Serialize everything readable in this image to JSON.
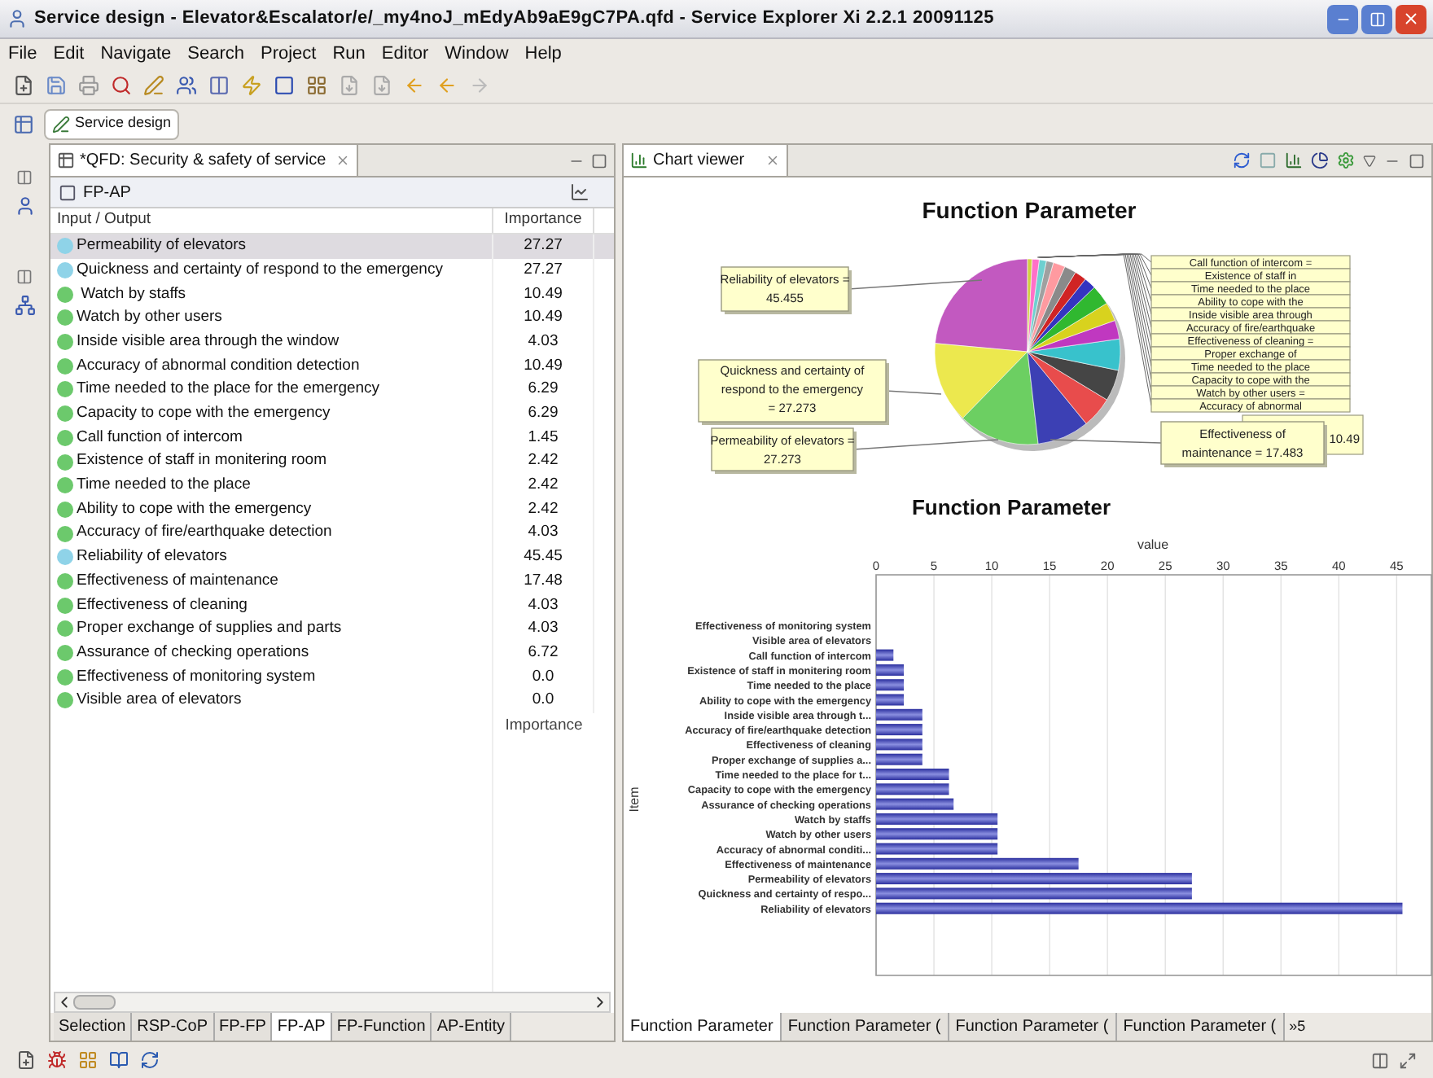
{
  "window": {
    "title": "Service design - Elevator&Escalator/e/_my4noJ_mEdyAb9aE9gC7PA.qfd - Service Explorer Xi 2.2.1 20091125"
  },
  "menu": [
    "File",
    "Edit",
    "Navigate",
    "Search",
    "Project",
    "Run",
    "Editor",
    "Window",
    "Help"
  ],
  "perspective": {
    "label": "Service design"
  },
  "editor": {
    "tab": "*QFD: Security & safety of service",
    "section": "FP-AP",
    "columns": [
      "Input / Output",
      "Importance"
    ],
    "rows": [
      {
        "name": "Permeability of elevators",
        "importance": "27.27",
        "color": "#8fd3e8",
        "selected": true
      },
      {
        "name": "Quickness and certainty of respond to the emergency",
        "importance": "27.27",
        "color": "#8fd3e8",
        "selected": false
      },
      {
        "name": " Watch by staffs",
        "importance": "10.49",
        "color": "#6cc96c",
        "selected": false
      },
      {
        "name": "Watch by other users",
        "importance": "10.49",
        "color": "#6cc96c",
        "selected": false
      },
      {
        "name": "Inside visible area through the window",
        "importance": "4.03",
        "color": "#6cc96c",
        "selected": false
      },
      {
        "name": "Accuracy of abnormal condition detection",
        "importance": "10.49",
        "color": "#6cc96c",
        "selected": false
      },
      {
        "name": "Time needed to the place for the emergency",
        "importance": "6.29",
        "color": "#6cc96c",
        "selected": false
      },
      {
        "name": "Capacity to cope with the emergency",
        "importance": "6.29",
        "color": "#6cc96c",
        "selected": false
      },
      {
        "name": "Call function of intercom",
        "importance": "1.45",
        "color": "#6cc96c",
        "selected": false
      },
      {
        "name": "Existence of staff in monitering room",
        "importance": "2.42",
        "color": "#6cc96c",
        "selected": false
      },
      {
        "name": "Time needed to the place",
        "importance": "2.42",
        "color": "#6cc96c",
        "selected": false
      },
      {
        "name": "Ability to cope with the emergency",
        "importance": "2.42",
        "color": "#6cc96c",
        "selected": false
      },
      {
        "name": "Accuracy of fire/earthquake detection",
        "importance": "4.03",
        "color": "#6cc96c",
        "selected": false
      },
      {
        "name": "Reliability of elevators",
        "importance": "45.45",
        "color": "#8fd3e8",
        "selected": false
      },
      {
        "name": "Effectiveness of maintenance",
        "importance": "17.48",
        "color": "#6cc96c",
        "selected": false
      },
      {
        "name": "Effectiveness of cleaning",
        "importance": "4.03",
        "color": "#6cc96c",
        "selected": false
      },
      {
        "name": "Proper exchange of supplies and parts",
        "importance": "4.03",
        "color": "#6cc96c",
        "selected": false
      },
      {
        "name": "Assurance of checking operations",
        "importance": "6.72",
        "color": "#6cc96c",
        "selected": false
      },
      {
        "name": "Effectiveness of monitoring system",
        "importance": "0.0",
        "color": "#6cc96c",
        "selected": false
      },
      {
        "name": "Visible area of elevators",
        "importance": "0.0",
        "color": "#6cc96c",
        "selected": false
      }
    ],
    "footer": "Importance",
    "sheet_tabs": [
      {
        "label": "Selection",
        "selected": false
      },
      {
        "label": "RSP-CoP",
        "selected": false
      },
      {
        "label": "FP-FP",
        "selected": false
      },
      {
        "label": "FP-AP",
        "selected": true
      },
      {
        "label": "FP-Function",
        "selected": false
      },
      {
        "label": "AP-Entity",
        "selected": false
      }
    ]
  },
  "chart_viewer": {
    "title": "Chart viewer",
    "pie": {
      "title": "Function Parameter",
      "callouts": [
        {
          "kind": "box",
          "lines": [
            "Reliability of elevators =",
            "45.455"
          ]
        },
        {
          "kind": "box",
          "lines": [
            "Quickness and certainty of",
            "respond to the emergency",
            "= 27.273"
          ]
        },
        {
          "kind": "box",
          "lines": [
            "Permeability of elevators =",
            "27.273"
          ]
        },
        {
          "kind": "stacked",
          "lines": [
            "Call function of intercom ="
          ]
        },
        {
          "kind": "stacked",
          "lines": [
            "Existence of staff in"
          ]
        },
        {
          "kind": "stacked",
          "lines": [
            "Time needed to the place"
          ]
        },
        {
          "kind": "stacked",
          "lines": [
            "Ability to cope with the"
          ]
        },
        {
          "kind": "stacked",
          "lines": [
            "Inside visible area through"
          ]
        },
        {
          "kind": "stacked",
          "lines": [
            "Accuracy of fire/earthquake"
          ]
        },
        {
          "kind": "stacked",
          "lines": [
            "Effectiveness of cleaning ="
          ]
        },
        {
          "kind": "stacked",
          "lines": [
            "Proper exchange of"
          ]
        },
        {
          "kind": "stacked",
          "lines": [
            "Time needed to the place"
          ]
        },
        {
          "kind": "stacked",
          "lines": [
            "Capacity to cope with the"
          ]
        },
        {
          "kind": "stacked",
          "lines": [
            "Watch by other users ="
          ]
        },
        {
          "kind": "stacked",
          "lines": [
            "Accuracy of abnormal"
          ]
        },
        {
          "kind": "box",
          "lines": [
            "Effectiveness of",
            "maintenance = 17.483"
          ]
        },
        {
          "kind": "tail",
          "lines": [
            "10.49"
          ]
        }
      ]
    },
    "bar": {
      "chart_data": {
        "type": "bar",
        "orientation": "horizontal",
        "title": "Function Parameter",
        "xlabel": "value",
        "ylabel": "Item",
        "categories": [
          "Effectiveness of monitoring system",
          "Visible area of elevators",
          "Call function of intercom",
          "Existence of staff in monitering room",
          "Time needed to the place",
          "Ability to cope with the emergency",
          "Inside visible area through t...",
          "Accuracy of fire/earthquake detection",
          "Effectiveness of cleaning",
          "Proper exchange of supplies a...",
          "Time needed to the place for t...",
          "Capacity to cope with the emergency",
          "Assurance of checking operations",
          "Watch by staffs",
          "Watch by other users",
          "Accuracy of abnormal conditi...",
          "Effectiveness of maintenance",
          "Permeability of elevators",
          "Quickness and certainty of respo...",
          "Reliability of elevators"
        ],
        "values": [
          0,
          0,
          1.5,
          2.4,
          2.4,
          2.4,
          4.0,
          4.0,
          4.0,
          4.0,
          6.3,
          6.3,
          6.7,
          10.5,
          10.5,
          10.5,
          17.5,
          27.3,
          27.3,
          45.5
        ],
        "xlim": [
          0,
          48
        ],
        "xticks": [
          0,
          5,
          10,
          15,
          20,
          25,
          30,
          35,
          40,
          45
        ],
        "grid": true
      }
    },
    "tabs": [
      {
        "label": "Function Parameter",
        "selected": true
      },
      {
        "label": "Function Parameter (",
        "selected": false
      },
      {
        "label": "Function Parameter (",
        "selected": false
      },
      {
        "label": "Function Parameter (",
        "selected": false
      }
    ],
    "overflow": "»5"
  }
}
